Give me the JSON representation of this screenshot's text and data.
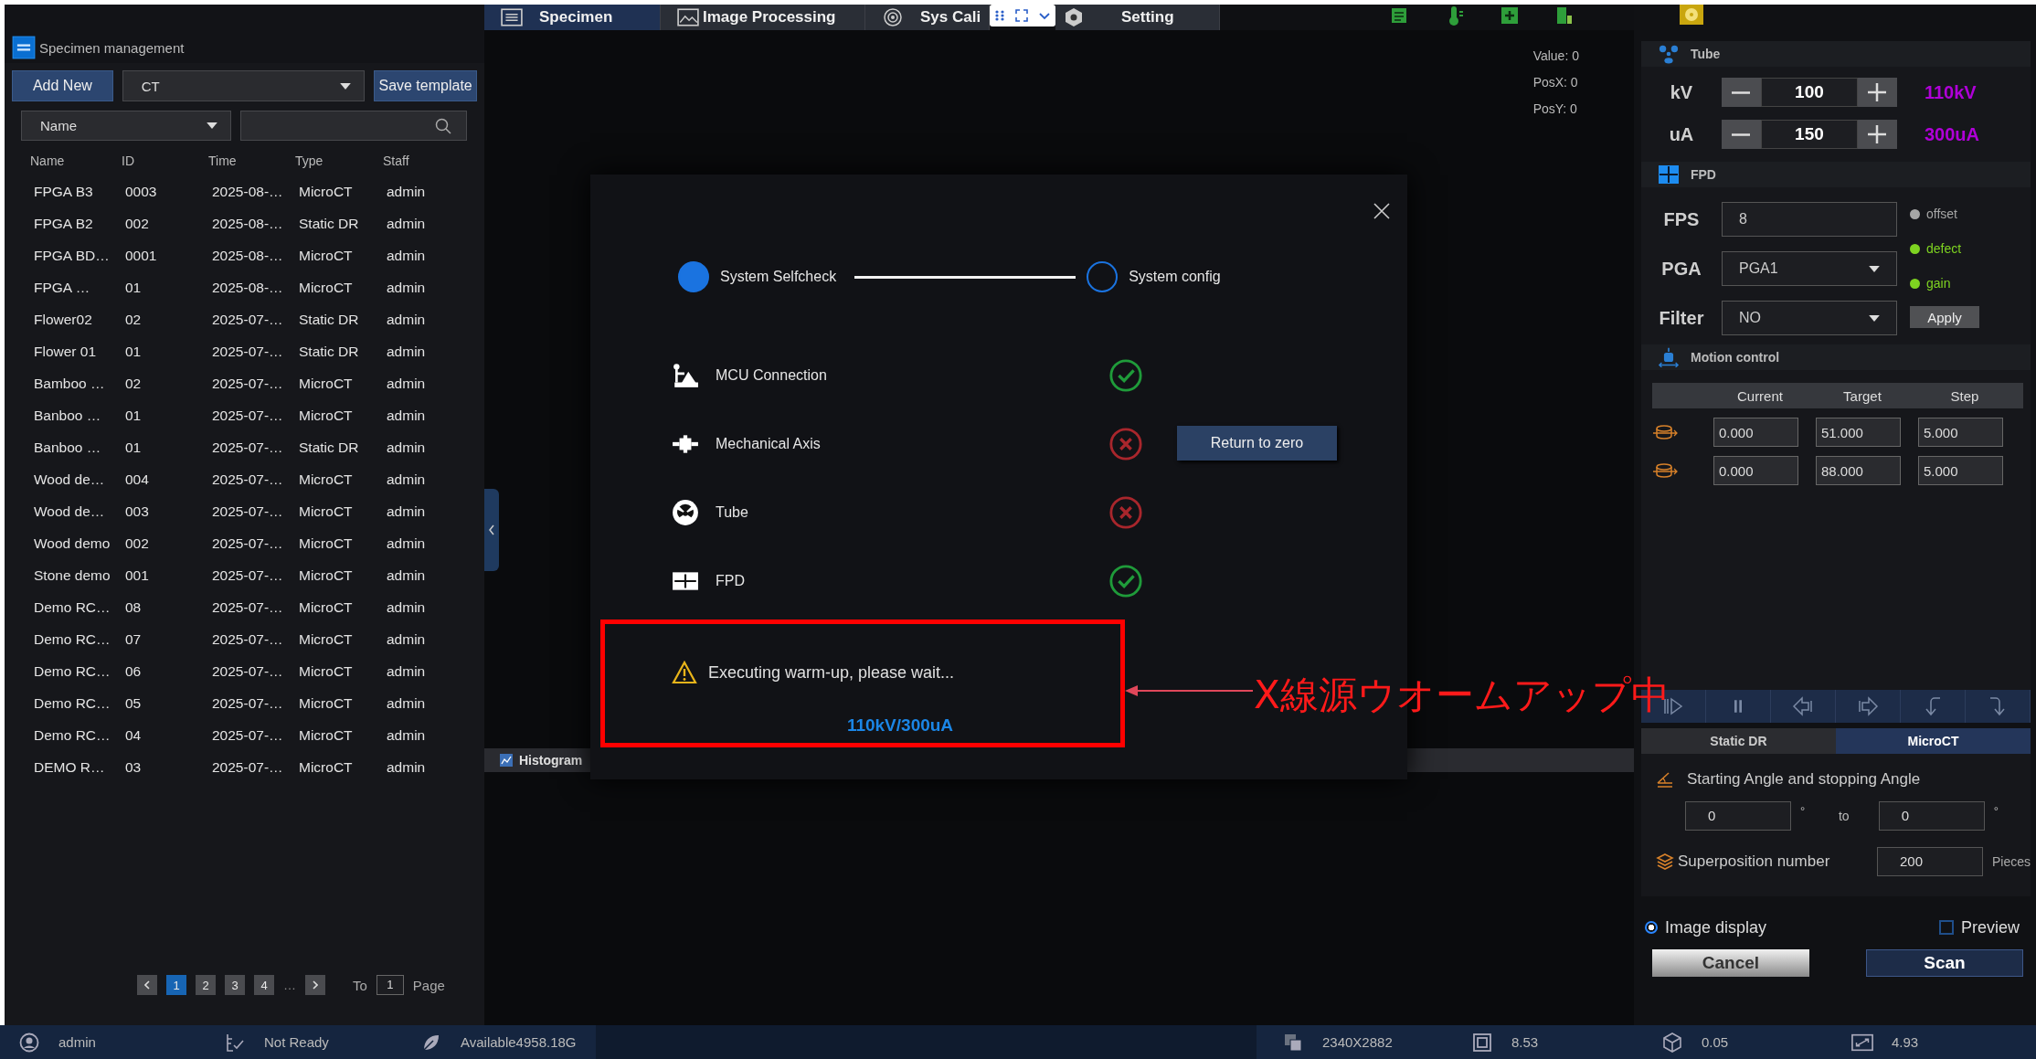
{
  "tabs": [
    {
      "label": "Specimen",
      "selected": true
    },
    {
      "label": "Image Processing",
      "selected": false
    },
    {
      "label": "Sys Cali",
      "selected": false
    },
    {
      "label": "Setting",
      "selected": false
    }
  ],
  "specimens": {
    "title": "Specimen management",
    "add_button": "Add New",
    "type_select": "CT",
    "save_button": "Save template",
    "filter_select": "Name",
    "columns": [
      "Name",
      "ID",
      "Time",
      "Type",
      "Staff"
    ],
    "rows": [
      [
        "FPGA B3",
        "0003",
        "2025-08-…",
        "MicroCT",
        "admin"
      ],
      [
        "FPGA B2",
        "002",
        "2025-08-…",
        "Static DR",
        "admin"
      ],
      [
        "FPGA BD…",
        "0001",
        "2025-08-…",
        "MicroCT",
        "admin"
      ],
      [
        "FPGA …",
        "01",
        "2025-08-…",
        "MicroCT",
        "admin"
      ],
      [
        "Flower02",
        "02",
        "2025-07-…",
        "Static DR",
        "admin"
      ],
      [
        "Flower 01",
        "01",
        "2025-07-…",
        "Static DR",
        "admin"
      ],
      [
        "Bamboo …",
        "02",
        "2025-07-…",
        "MicroCT",
        "admin"
      ],
      [
        "Banboo …",
        "01",
        "2025-07-…",
        "MicroCT",
        "admin"
      ],
      [
        "Banboo …",
        "01",
        "2025-07-…",
        "Static DR",
        "admin"
      ],
      [
        "Wood de…",
        "004",
        "2025-07-…",
        "MicroCT",
        "admin"
      ],
      [
        "Wood de…",
        "003",
        "2025-07-…",
        "MicroCT",
        "admin"
      ],
      [
        "Wood demo",
        "002",
        "2025-07-…",
        "MicroCT",
        "admin"
      ],
      [
        "Stone demo",
        "001",
        "2025-07-…",
        "MicroCT",
        "admin"
      ],
      [
        "Demo RC…",
        "08",
        "2025-07-…",
        "MicroCT",
        "admin"
      ],
      [
        "Demo RC…",
        "07",
        "2025-07-…",
        "MicroCT",
        "admin"
      ],
      [
        "Demo RC…",
        "06",
        "2025-07-…",
        "MicroCT",
        "admin"
      ],
      [
        "Demo RC…",
        "05",
        "2025-07-…",
        "MicroCT",
        "admin"
      ],
      [
        "Demo RC…",
        "04",
        "2025-07-…",
        "MicroCT",
        "admin"
      ],
      [
        "DEMO R…",
        "03",
        "2025-07-…",
        "MicroCT",
        "admin"
      ]
    ],
    "pagination": {
      "pages": [
        {
          "label": "1",
          "selected": true
        },
        {
          "label": "2",
          "selected": false
        },
        {
          "label": "3",
          "selected": false
        },
        {
          "label": "4",
          "selected": false
        }
      ],
      "ellipsis": "…",
      "goto_label": "To",
      "goto_value": "1",
      "page_label": "Page"
    }
  },
  "viewer": {
    "readouts": [
      "Value: 0",
      "PosX: 0",
      "PosY: 0"
    ],
    "histogram_label": "Histogram"
  },
  "dialog": {
    "steps": [
      {
        "label": "System Selfcheck",
        "selected": true
      },
      {
        "label": "System config",
        "selected": false
      }
    ],
    "checks": [
      {
        "kind": "mcu",
        "label": "MCU Connection",
        "ok": true
      },
      {
        "kind": "axis",
        "label": "Mechanical Axis",
        "ok": false
      },
      {
        "kind": "tube",
        "label": "Tube",
        "ok": false
      },
      {
        "kind": "fpd",
        "label": "FPD",
        "ok": true
      }
    ],
    "return_button": "Return to zero",
    "warning": "Executing warm-up, please wait...",
    "setting": "110kV/300uA"
  },
  "annotation": {
    "text": "X線源ウオームアップ中"
  },
  "tube": {
    "title": "Tube",
    "params": [
      {
        "label": "kV",
        "value": "100",
        "reading": "110kV"
      },
      {
        "label": "uA",
        "value": "150",
        "reading": "300uA"
      }
    ]
  },
  "fpd": {
    "title": "FPD",
    "fps_label": "FPS",
    "fps": "8",
    "pga_label": "PGA",
    "pga": "PGA1",
    "filter_label": "Filter",
    "filter": "NO",
    "status": [
      {
        "label": "offset",
        "color": "#a6a6a6"
      },
      {
        "label": "defect",
        "color": "#7ed321"
      },
      {
        "label": "gain",
        "color": "#7ed321"
      }
    ],
    "apply_button": "Apply"
  },
  "motion": {
    "title": "Motion control",
    "columns": [
      "Current",
      "Target",
      "Step"
    ],
    "axes": [
      {
        "values": [
          "0.000",
          "51.000",
          "5.000"
        ]
      },
      {
        "values": [
          "0.000",
          "88.000",
          "5.000"
        ]
      }
    ]
  },
  "modes": [
    {
      "label": "Static DR",
      "selected": false
    },
    {
      "label": "MicroCT",
      "selected": true
    }
  ],
  "scan": {
    "angle_title": "Starting Angle and stopping Angle",
    "start": "0",
    "start_unit": "°",
    "to": "to",
    "end": "0",
    "end_unit": "°",
    "superposition_label": "Superposition number",
    "superposition": "200",
    "superposition_unit": "Pieces",
    "image_display": {
      "label": "Image display",
      "checked": true
    },
    "preview": {
      "label": "Preview",
      "checked": false
    },
    "cancel_button": "Cancel",
    "scan_button": "Scan"
  },
  "status_bar": {
    "user": "admin",
    "state": "Not Ready",
    "storage": "Available4958.18G",
    "resolution": "2340X2882",
    "metrics": [
      "8.53",
      "0.05",
      "4.93"
    ]
  }
}
